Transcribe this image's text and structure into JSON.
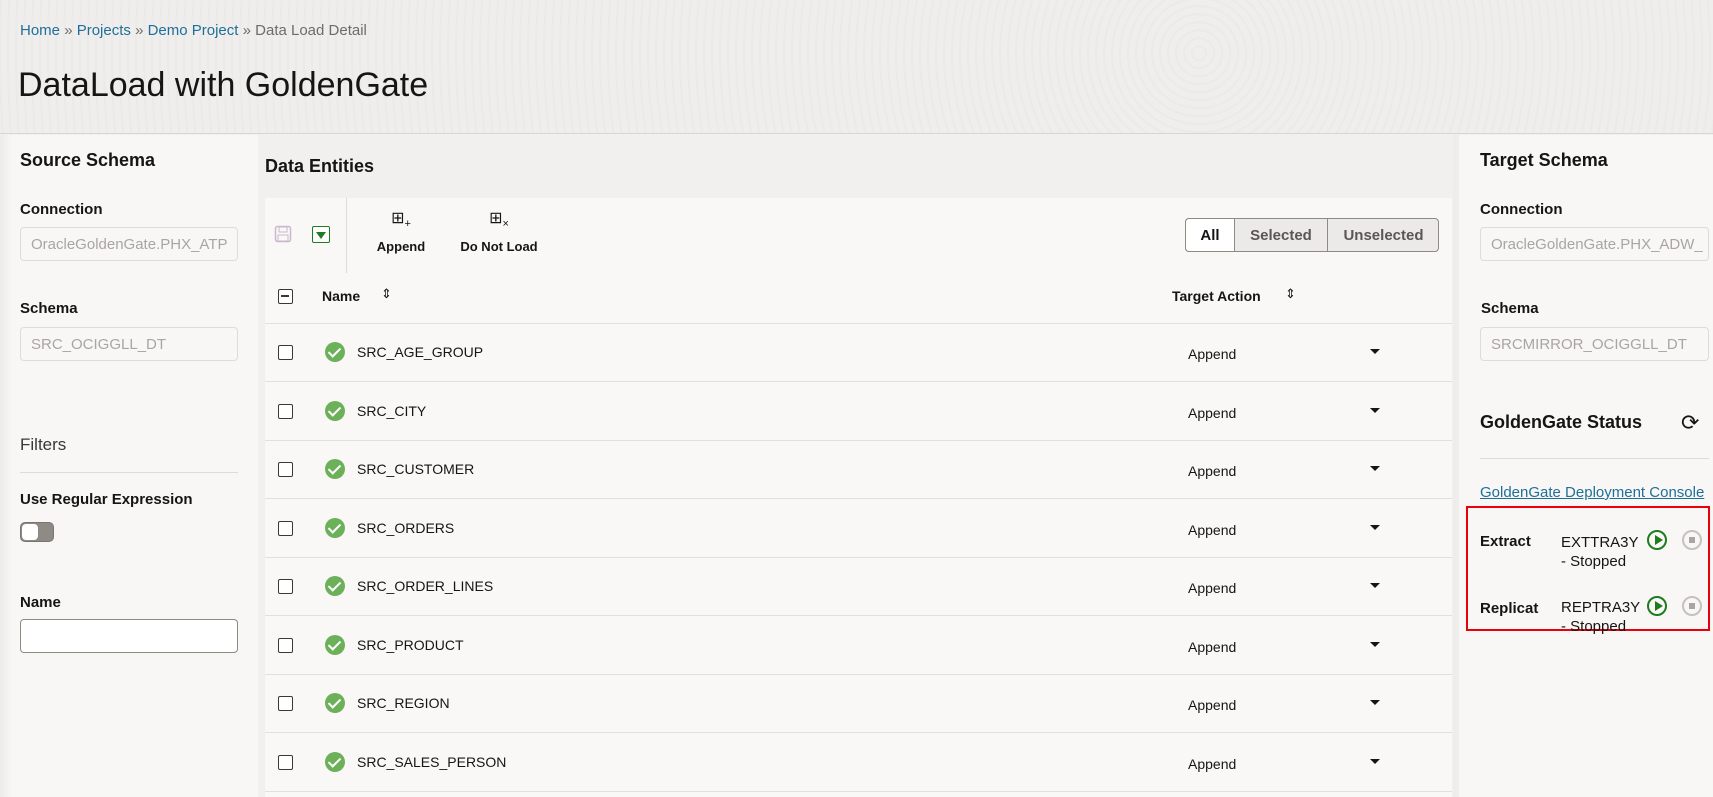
{
  "breadcrumb": {
    "home": "Home",
    "projects": "Projects",
    "demo": "Demo Project",
    "current": "Data Load Detail",
    "sep": "»"
  },
  "title": "DataLoad with GoldenGate",
  "source": {
    "heading": "Source Schema",
    "connection_label": "Connection",
    "connection_value": "OracleGoldenGate.PHX_ATP",
    "schema_label": "Schema",
    "schema_value": "SRC_OCIGGLL_DT"
  },
  "filters": {
    "heading": "Filters",
    "regex_label": "Use Regular Expression",
    "regex_on": false,
    "name_label": "Name",
    "name_value": ""
  },
  "entities": {
    "heading": "Data Entities",
    "append_label": "Append",
    "do_not_load_label": "Do Not Load",
    "segments": [
      "All",
      "Selected",
      "Unselected"
    ],
    "selected_segment": "All",
    "col_name": "Name",
    "col_action": "Target Action",
    "rows": [
      {
        "name": "SRC_AGE_GROUP",
        "action": "Append"
      },
      {
        "name": "SRC_CITY",
        "action": "Append"
      },
      {
        "name": "SRC_CUSTOMER",
        "action": "Append"
      },
      {
        "name": "SRC_ORDERS",
        "action": "Append"
      },
      {
        "name": "SRC_ORDER_LINES",
        "action": "Append"
      },
      {
        "name": "SRC_PRODUCT",
        "action": "Append"
      },
      {
        "name": "SRC_REGION",
        "action": "Append"
      },
      {
        "name": "SRC_SALES_PERSON",
        "action": "Append"
      }
    ]
  },
  "target": {
    "heading": "Target Schema",
    "connection_label": "Connection",
    "connection_value": "OracleGoldenGate.PHX_ADW_",
    "schema_label": "Schema",
    "schema_value": "SRCMIRROR_OCIGGLL_DT"
  },
  "gg": {
    "heading": "GoldenGate Status",
    "console_link": "GoldenGate Deployment Console",
    "extract_label": "Extract",
    "extract_name": "EXTTRA3Y",
    "extract_status": "- Stopped",
    "replicat_label": "Replicat",
    "replicat_name": "REPTRA3Y",
    "replicat_status": "- Stopped"
  },
  "colors": {
    "link": "#1f6f99",
    "highlight": "#e8000b",
    "ok": "#6cb159",
    "play": "#1e7b1e"
  }
}
